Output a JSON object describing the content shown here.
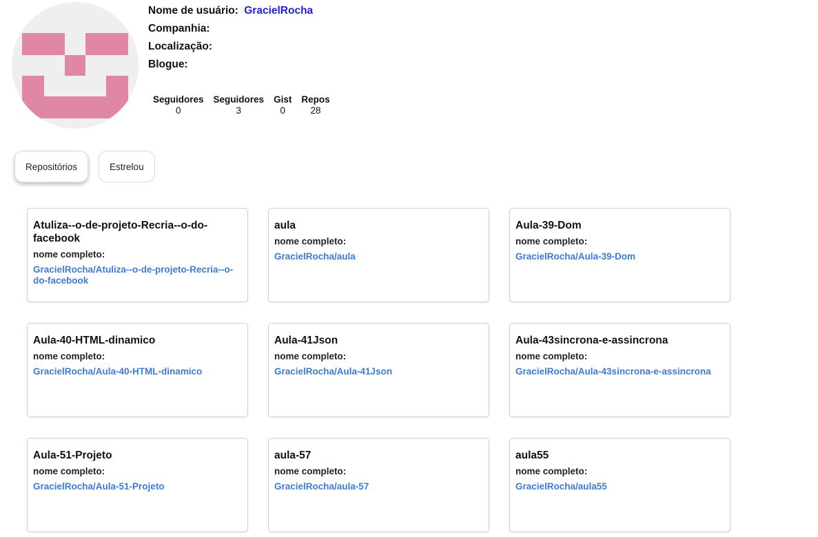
{
  "profile": {
    "username_label": "Nome de usuário:",
    "username": "GracielRocha",
    "company_label": "Companhia:",
    "company": "",
    "location_label": "Localização:",
    "location": "",
    "blog_label": "Blogue:",
    "blog": "",
    "avatar_color": "#e086a6"
  },
  "stats": [
    {
      "label": "Seguidores",
      "value": "0"
    },
    {
      "label": "Seguidores",
      "value": "3"
    },
    {
      "label": "Gist",
      "value": "0"
    },
    {
      "label": "Repos",
      "value": "28"
    }
  ],
  "tabs": [
    {
      "label": "Repositórios",
      "active": true
    },
    {
      "label": "Estrelou",
      "active": false
    }
  ],
  "repos": [
    {
      "name": "Atuliza--o-de-projeto-Recria--o-do-facebook",
      "subtitle": "nome completo:",
      "full_name": "GracielRocha/Atuliza--o-de-projeto-Recria--o-do-facebook"
    },
    {
      "name": "aula",
      "subtitle": "nome completo:",
      "full_name": "GracielRocha/aula"
    },
    {
      "name": "Aula-39-Dom",
      "subtitle": "nome completo:",
      "full_name": "GracielRocha/Aula-39-Dom"
    },
    {
      "name": "Aula-40-HTML-dinamico",
      "subtitle": "nome completo:",
      "full_name": "GracielRocha/Aula-40-HTML-dinamico"
    },
    {
      "name": "Aula-41Json",
      "subtitle": "nome completo:",
      "full_name": "GracielRocha/Aula-41Json"
    },
    {
      "name": "Aula-43sincrona-e-assincrona",
      "subtitle": "nome completo:",
      "full_name": "GracielRocha/Aula-43sincrona-e-assincrona"
    },
    {
      "name": "Aula-51-Projeto",
      "subtitle": "nome completo:",
      "full_name": "GracielRocha/Aula-51-Projeto"
    },
    {
      "name": "aula-57",
      "subtitle": "nome completo:",
      "full_name": "GracielRocha/aula-57"
    },
    {
      "name": "aula55",
      "subtitle": "nome completo:",
      "full_name": "GracielRocha/aula55"
    }
  ]
}
